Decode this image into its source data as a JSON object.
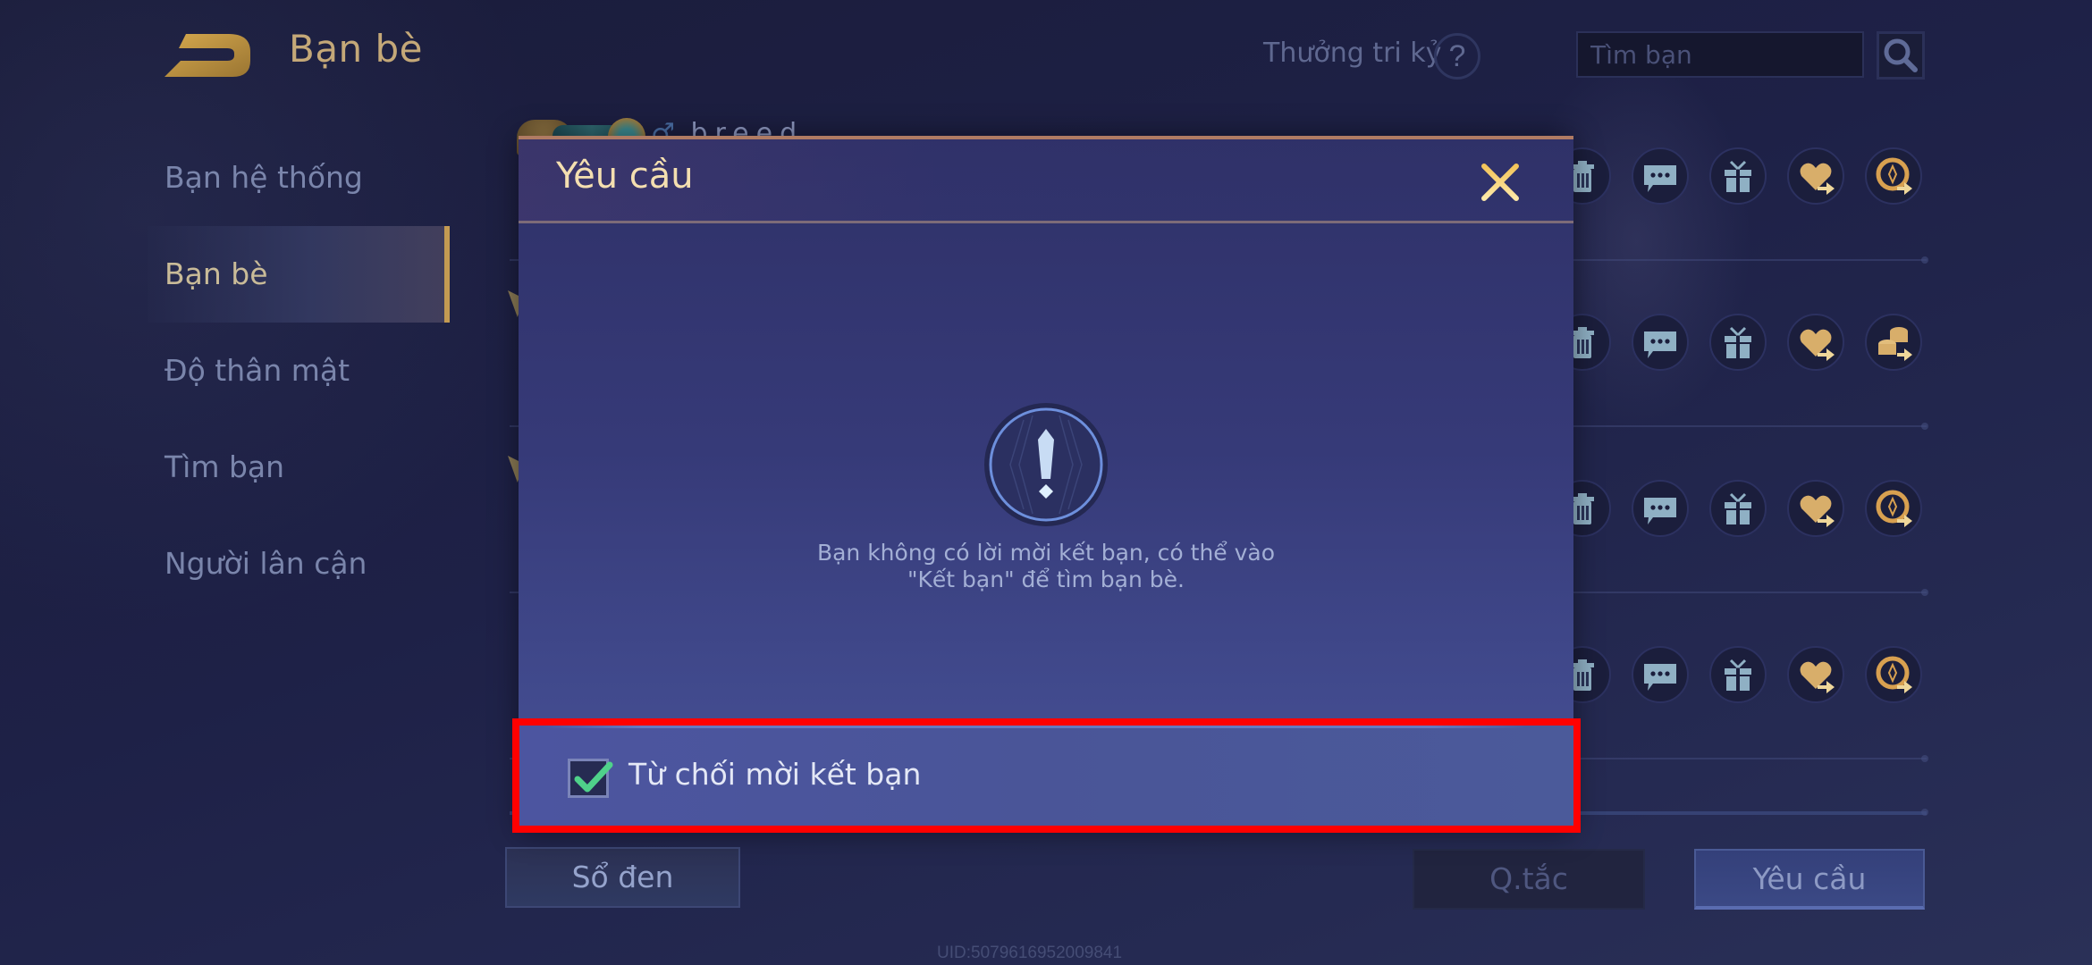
{
  "header": {
    "title": "Bạn bè",
    "back_icon": "back-arrow-icon",
    "reward_label": "Thưởng tri kỷ",
    "help_symbol": "?",
    "search_placeholder": "Tìm bạn",
    "search_value": "",
    "search_icon": "search-icon"
  },
  "sidebar": {
    "active_index": 1,
    "items": [
      {
        "label": "Bạn hệ thống"
      },
      {
        "label": "Bạn bè"
      },
      {
        "label": "Độ thân mật"
      },
      {
        "label": "Tìm bạn"
      },
      {
        "label": "Người lân cận"
      }
    ]
  },
  "friend_list": {
    "first_row_name_partial": "breed",
    "row_actions": [
      [
        "delete-icon",
        "chat-icon",
        "gift-icon",
        "send-heart-icon",
        "send-medal-icon"
      ],
      [
        "delete-icon",
        "chat-icon",
        "gift-icon",
        "send-heart-icon",
        "send-coins-icon"
      ],
      [
        "delete-icon",
        "chat-icon",
        "gift-icon",
        "send-heart-icon",
        "send-medal-icon"
      ],
      [
        "delete-icon",
        "chat-icon",
        "gift-icon",
        "send-heart-icon",
        "send-medal-icon"
      ]
    ]
  },
  "bottom_bar": {
    "blacklist_label": "Sổ đen",
    "rules_label": "Q.tắc",
    "requests_label": "Yêu cầu",
    "uid": "UID:5079616952009841"
  },
  "modal": {
    "title": "Yêu cầu",
    "close_icon": "close-icon",
    "alert_icon": "exclamation-icon",
    "message_line1": "Bạn không có lời mời kết bạn, có thể vào",
    "message_line2": "\"Kết bạn\" để tìm bạn bè.",
    "reject_checkbox": {
      "label": "Từ chối mời kết bạn",
      "checked": true
    }
  },
  "colors": {
    "accent_gold": "#c4a878",
    "highlight_red": "#ff0000",
    "check_green": "#4fd18a"
  }
}
